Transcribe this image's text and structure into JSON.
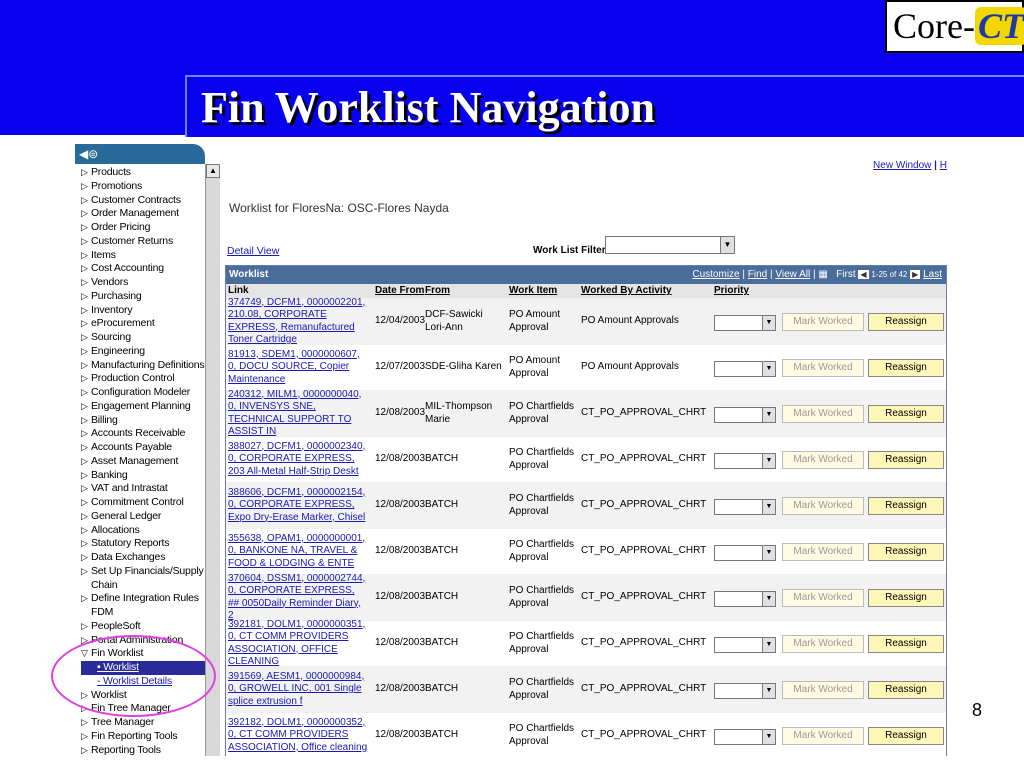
{
  "slide": {
    "title": "Fin Worklist Navigation",
    "logo_core": "Core-",
    "logo_ct": "CT",
    "page_number": "8"
  },
  "nav": {
    "items": [
      {
        "label": "Products",
        "type": "folder"
      },
      {
        "label": "Promotions",
        "type": "folder"
      },
      {
        "label": "Customer Contracts",
        "type": "folder"
      },
      {
        "label": "Order Management",
        "type": "folder"
      },
      {
        "label": "Order Pricing",
        "type": "folder"
      },
      {
        "label": "Customer Returns",
        "type": "folder"
      },
      {
        "label": "Items",
        "type": "folder"
      },
      {
        "label": "Cost Accounting",
        "type": "folder"
      },
      {
        "label": "Vendors",
        "type": "folder"
      },
      {
        "label": "Purchasing",
        "type": "folder"
      },
      {
        "label": "Inventory",
        "type": "folder"
      },
      {
        "label": "eProcurement",
        "type": "folder"
      },
      {
        "label": "Sourcing",
        "type": "folder"
      },
      {
        "label": "Engineering",
        "type": "folder"
      },
      {
        "label": "Manufacturing Definitions",
        "type": "folder"
      },
      {
        "label": "Production Control",
        "type": "folder"
      },
      {
        "label": "Configuration Modeler",
        "type": "folder"
      },
      {
        "label": "Engagement Planning",
        "type": "folder"
      },
      {
        "label": "Billing",
        "type": "folder"
      },
      {
        "label": "Accounts Receivable",
        "type": "folder"
      },
      {
        "label": "Accounts Payable",
        "type": "folder"
      },
      {
        "label": "Asset Management",
        "type": "folder"
      },
      {
        "label": "Banking",
        "type": "folder"
      },
      {
        "label": "VAT and Intrastat",
        "type": "folder"
      },
      {
        "label": "Commitment Control",
        "type": "folder"
      },
      {
        "label": "General Ledger",
        "type": "folder"
      },
      {
        "label": "Allocations",
        "type": "folder"
      },
      {
        "label": "Statutory Reports",
        "type": "folder"
      },
      {
        "label": "Data Exchanges",
        "type": "folder"
      },
      {
        "label": "Set Up Financials/Supply",
        "type": "folder"
      },
      {
        "label": "Chain",
        "type": "cont"
      },
      {
        "label": "Define Integration Rules",
        "type": "folder"
      },
      {
        "label": "FDM",
        "type": "cont"
      },
      {
        "label": "PeopleSoft",
        "type": "folder"
      },
      {
        "label": "Portal Administration",
        "type": "folder"
      },
      {
        "label": "Fin Worklist",
        "type": "open"
      },
      {
        "label": "Worklist",
        "type": "active"
      },
      {
        "label": "Worklist Details",
        "type": "link"
      },
      {
        "label": "Worklist",
        "type": "folder"
      },
      {
        "label": "Fin Tree Manager",
        "type": "folder"
      },
      {
        "label": "Tree Manager",
        "type": "folder"
      },
      {
        "label": "Fin Reporting Tools",
        "type": "folder"
      },
      {
        "label": "Reporting Tools",
        "type": "folder"
      }
    ]
  },
  "main": {
    "new_window": "New Window",
    "sep": "|",
    "help": "H",
    "worklist_for": "Worklist for FloresNa: OSC-Flores Nayda",
    "detail_view": "Detail View",
    "filters_label": "Work List Filters:",
    "grid_title": "Worklist",
    "customize": "Customize",
    "find": "Find",
    "view_all": "View All",
    "first": "First",
    "range": "1-25 of 42",
    "last": "Last",
    "headers": {
      "link": "Link",
      "date_from": "Date From",
      "from": "From",
      "work_item": "Work Item",
      "worked_by": "Worked By Activity",
      "priority": "Priority"
    },
    "mark_worked": "Mark Worked",
    "reassign": "Reassign",
    "rows": [
      {
        "link": "374749, DCFM1, 0000002201, 210.08, CORPORATE EXPRESS, Remanufactured Toner Cartridge",
        "date": "12/04/2003",
        "from": "DCF-Sawicki Lori-Ann",
        "item": "PO Amount Approval",
        "activity": "PO Amount Approvals"
      },
      {
        "link": "81913, SDEM1, 0000000607, 0, DOCU SOURCE, Copier Maintenance",
        "date": "12/07/2003",
        "from": "SDE-Gliha Karen",
        "item": "PO Amount Approval",
        "activity": "PO Amount Approvals"
      },
      {
        "link": "240312, MILM1, 0000000040, 0, INVENSYS SNE, TECHNICAL SUPPORT TO ASSIST IN",
        "date": "12/08/2003",
        "from": "MIL-Thompson Marie",
        "item": "PO Chartfields Approval",
        "activity": "CT_PO_APPROVAL_CHRT"
      },
      {
        "link": "388027, DCFM1, 0000002340, 0, CORPORATE EXPRESS, 203 All-Metal Half-Strip Deskt",
        "date": "12/08/2003",
        "from": "BATCH",
        "item": "PO Chartfields Approval",
        "activity": "CT_PO_APPROVAL_CHRT"
      },
      {
        "link": "388606, DCFM1, 0000002154, 0, CORPORATE EXPRESS, Expo Dry-Erase Marker, Chisel",
        "date": "12/08/2003",
        "from": "BATCH",
        "item": "PO Chartfields Approval",
        "activity": "CT_PO_APPROVAL_CHRT"
      },
      {
        "link": "355638, OPAM1, 0000000001, 0, BANKONE NA, TRAVEL & FOOD & LODGING & ENTE",
        "date": "12/08/2003",
        "from": "BATCH",
        "item": "PO Chartfields Approval",
        "activity": "CT_PO_APPROVAL_CHRT"
      },
      {
        "link": "370604, DSSM1, 0000002744, 0, CORPORATE EXPRESS, ## 0050Daily Reminder Diary, 2",
        "date": "12/08/2003",
        "from": "BATCH",
        "item": "PO Chartfields Approval",
        "activity": "CT_PO_APPROVAL_CHRT"
      },
      {
        "link": "392181, DOLM1, 0000000351, 0, CT COMM PROVIDERS ASSOCIATION, OFFICE CLEANING",
        "date": "12/08/2003",
        "from": "BATCH",
        "item": "PO Chartfields Approval",
        "activity": "CT_PO_APPROVAL_CHRT"
      },
      {
        "link": "391569, AESM1, 0000000984, 0, GROWELL INC, 001 Single splice extrusion f",
        "date": "12/08/2003",
        "from": "BATCH",
        "item": "PO Chartfields Approval",
        "activity": "CT_PO_APPROVAL_CHRT"
      },
      {
        "link": "392182, DOLM1, 0000000352, 0, CT COMM PROVIDERS ASSOCIATION, Office cleaning",
        "date": "12/08/2003",
        "from": "BATCH",
        "item": "PO Chartfields Approval",
        "activity": "CT_PO_APPROVAL_CHRT"
      }
    ]
  },
  "colors": {
    "band": "#0a00f0",
    "title_text": "#ffffff",
    "grid_header": "#4a6c9a",
    "link": "#1a1ab0",
    "highlight": "#e040e0"
  }
}
